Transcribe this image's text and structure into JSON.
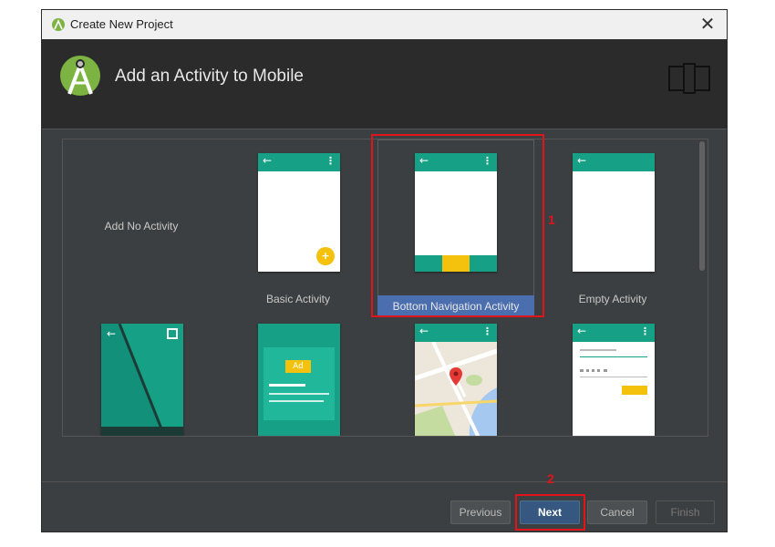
{
  "window": {
    "title": "Create New Project",
    "close_glyph": "✕"
  },
  "header": {
    "title": "Add an Activity to Mobile",
    "logo_icon": "android-studio-icon",
    "device_icon": "phone-tablet-icon"
  },
  "templates": [
    {
      "label": "Add No Activity",
      "selected": false
    },
    {
      "label": "Basic Activity",
      "selected": false,
      "fab_glyph": "+"
    },
    {
      "label": "Bottom Navigation Activity",
      "selected": true
    },
    {
      "label": "Empty Activity",
      "selected": false
    },
    {
      "label": "",
      "selected": false,
      "preview": "fullscreen"
    },
    {
      "label": "",
      "selected": false,
      "preview": "admob",
      "ad_text": "Ad"
    },
    {
      "label": "",
      "selected": false,
      "preview": "maps"
    },
    {
      "label": "",
      "selected": false,
      "preview": "login"
    }
  ],
  "buttons": {
    "previous": "Previous",
    "next": "Next",
    "cancel": "Cancel",
    "finish": "Finish"
  },
  "annotations": {
    "one": "1",
    "two": "2"
  },
  "colors": {
    "teal": "#16a085",
    "accent_yellow": "#f4c20d",
    "selection_blue": "#4b6eaf",
    "annotation_red": "#e0141a"
  }
}
